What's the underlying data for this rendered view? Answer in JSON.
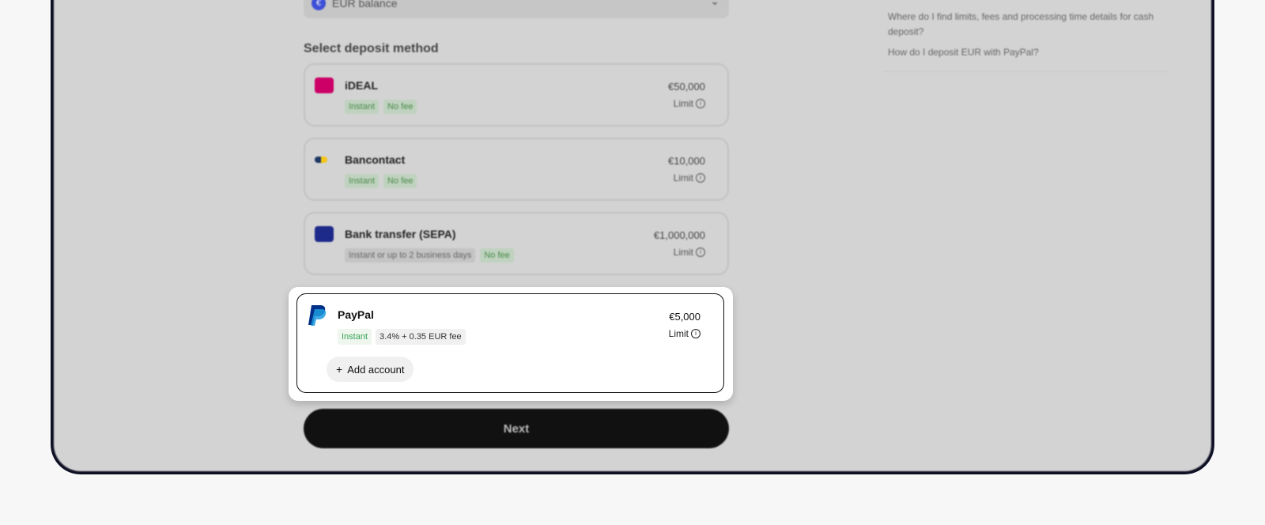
{
  "balance_select": {
    "icon": "euro-icon",
    "label": "EUR balance"
  },
  "section_title": "Select deposit method",
  "methods": [
    {
      "name": "iDEAL",
      "tags": [
        "Instant",
        "No fee"
      ],
      "amount": "€50,000",
      "limit_label": "Limit",
      "logo_color": "#cc0066"
    },
    {
      "name": "Bancontact",
      "tags": [
        "Instant",
        "No fee"
      ],
      "amount": "€10,000",
      "limit_label": "Limit",
      "logo_color": "#1e3764"
    },
    {
      "name": "Bank transfer (SEPA)",
      "tags": [
        "Instant or up to 2 business days",
        "No fee"
      ],
      "amount": "€1,000,000",
      "limit_label": "Limit",
      "logo_color": "#1d2a8a"
    }
  ],
  "paypal": {
    "name": "PayPal",
    "tag_speed": "Instant",
    "tag_fee": "3.4% + 0.35 EUR fee",
    "amount": "€5,000",
    "limit_label": "Limit",
    "add_account_label": "Add account"
  },
  "next_label": "Next",
  "faq": [
    "Where do I find limits, fees and processing time details for cash deposit?",
    "How do I deposit EUR with PayPal?"
  ],
  "colors": {
    "accent_green": "#3aa55a",
    "primary_button": "#111111",
    "euro_badge": "#3d4fd6"
  }
}
